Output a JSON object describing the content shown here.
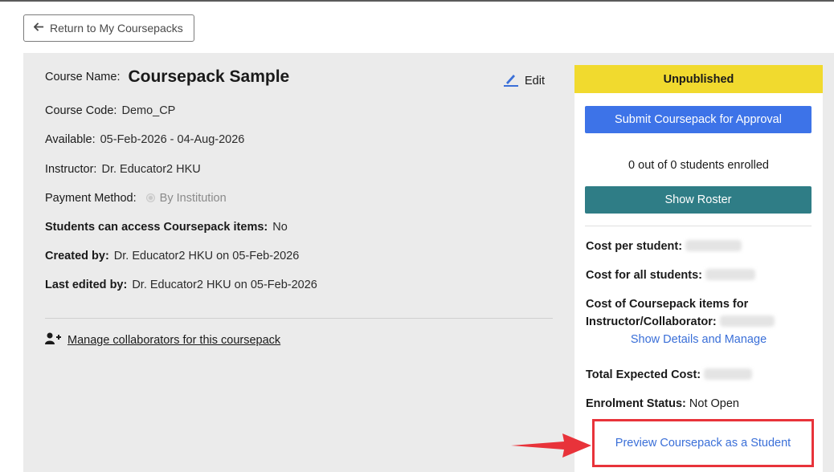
{
  "nav": {
    "return_label": "Return to My Coursepacks"
  },
  "course": {
    "name_label": "Course Name:",
    "name_value": "Coursepack Sample",
    "edit_label": "Edit",
    "code_label": "Course Code:",
    "code_value": "Demo_CP",
    "available_label": "Available:",
    "available_value": "05-Feb-2026 - 04-Aug-2026",
    "instructor_label": "Instructor:",
    "instructor_value": "Dr. Educator2 HKU",
    "payment_label": "Payment Method:",
    "payment_value": "By Institution",
    "access_label": "Students can access Coursepack items:",
    "access_value": "No",
    "created_label": "Created by:",
    "created_value": "Dr. Educator2 HKU on 05-Feb-2026",
    "edited_label": "Last edited by:",
    "edited_value": "Dr. Educator2 HKU on 05-Feb-2026",
    "collaborators_link": "Manage collaborators for this coursepack"
  },
  "sidebar": {
    "status": "Unpublished",
    "status_color": "#f1da2e",
    "submit_label": "Submit Coursepack for Approval",
    "enrolled_text": "0 out of 0 students enrolled",
    "roster_label": "Show Roster",
    "cost_per_student_label": "Cost per student:",
    "cost_all_label": "Cost for all students:",
    "cost_items_label_1": "Cost of Coursepack items for",
    "cost_items_label_2": "Instructor/Collaborator:",
    "details_link": "Show Details and Manage",
    "total_label": "Total Expected Cost:",
    "enrolment_label": "Enrolment Status:",
    "enrolment_value": "Not Open",
    "preview_link": "Preview Coursepack as a Student"
  },
  "colors": {
    "primary_button": "#3d73e8",
    "roster_button": "#2f7d86",
    "link": "#3a6fd8",
    "highlight_border": "#e8333a"
  },
  "icons": [
    "arrow-left-icon",
    "pencil-icon",
    "user-plus-icon",
    "red-pointer-arrow-icon"
  ]
}
